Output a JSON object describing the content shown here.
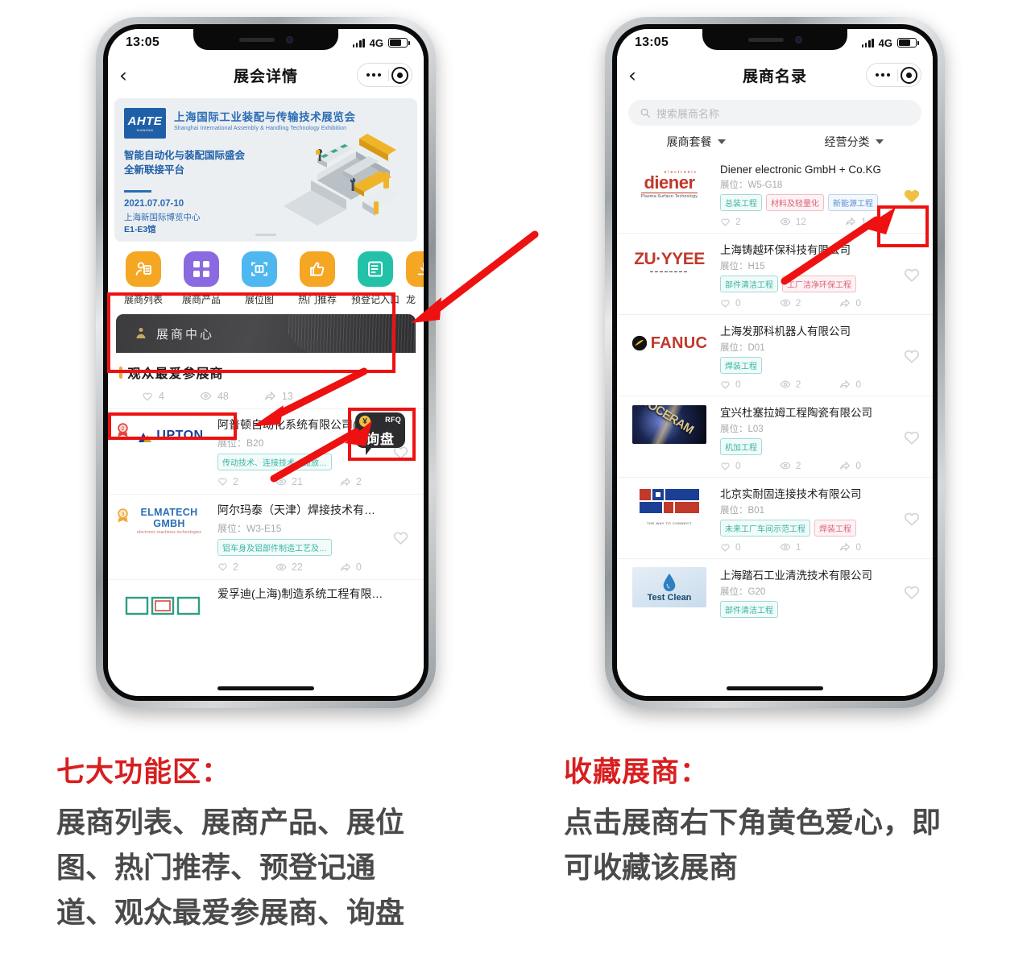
{
  "left_phone": {
    "status": {
      "time": "13:05",
      "network": "4G"
    },
    "nav": {
      "back_icon": "chevron-left-icon",
      "title": "展会详情",
      "more_icon": "more-dots-icon",
      "capsule_icon": "target-icon"
    },
    "banner": {
      "logo_text": "AHTE",
      "logo_sub": "SHANGHAI",
      "title_cn": "上海国际工业装配与传输技术展览会",
      "title_en": "Shanghai International Assembly & Handling Technology Exhibition",
      "slogan_line1": "智能自动化与装配国际盛会",
      "slogan_line2": "全新联接平台",
      "date": "2021.07.07-10",
      "venue": "上海新国际博览中心",
      "hall": "E1-E3馆"
    },
    "icon_menu": [
      {
        "label": "展商列表",
        "icon": "exhibitor-list-icon",
        "color": "#f5a623"
      },
      {
        "label": "展商产品",
        "icon": "grid-products-icon",
        "color": "#8a6ae0"
      },
      {
        "label": "展位图",
        "icon": "floor-plan-icon",
        "color": "#4fb7f0"
      },
      {
        "label": "热门推荐",
        "icon": "thumbs-up-icon",
        "color": "#f5a623"
      },
      {
        "label": "预登记入口",
        "icon": "document-icon",
        "color": "#23c2a8"
      },
      {
        "label": "龙",
        "icon": "partial-icon",
        "color": "#f5a623"
      }
    ],
    "center_card": {
      "label": "展商中心",
      "icon": "person-icon"
    },
    "section": {
      "title": "观众最爱参展商"
    },
    "rfq_button": {
      "badge": "RFQ",
      "label": "询盘",
      "currency": "¥"
    },
    "top_stats": {
      "likes": "4",
      "views": "48",
      "shares": "13"
    },
    "exhibitors": [
      {
        "rank": "2",
        "logo": "UPTON",
        "name": "阿普顿自动化系统有限公司(苏…",
        "booth_label": "展位：",
        "booth": "B20",
        "tags": [
          {
            "text": "传动技术、连接技术、搬放…",
            "style": "teal"
          }
        ],
        "likes": "2",
        "views": "21",
        "shares": "2",
        "favorited": false
      },
      {
        "rank": "3",
        "logo": "ELMATECH GMBH",
        "logo_sub": "electronic    machines    technologies",
        "name": "阿尔玛泰（天津）焊接技术有限…",
        "booth_label": "展位：",
        "booth": "W3-E15",
        "tags": [
          {
            "text": "铝车身及铝部件制造工艺及…",
            "style": "teal"
          }
        ],
        "likes": "2",
        "views": "22",
        "shares": "0",
        "favorited": false
      },
      {
        "rank": "",
        "logo": "",
        "name": "爱孚迪(上海)制造系统工程有限…",
        "booth_label": "",
        "booth": "",
        "tags": [],
        "likes": "",
        "views": "",
        "shares": "",
        "favorited": false
      }
    ]
  },
  "right_phone": {
    "status": {
      "time": "13:05",
      "network": "4G"
    },
    "nav": {
      "back_icon": "chevron-left-icon",
      "title": "展商名录",
      "more_icon": "more-dots-icon",
      "capsule_icon": "target-icon"
    },
    "search": {
      "placeholder": "搜索展商名称",
      "icon": "search-icon"
    },
    "filters": [
      {
        "label": "展商套餐",
        "icon": "chevron-down-icon"
      },
      {
        "label": "经营分类",
        "icon": "chevron-down-icon"
      }
    ],
    "exhibitors": [
      {
        "logo": "diener",
        "logo_top": "electronic",
        "logo_sub": "Plasma-Surface-Technology",
        "name": "Diener electronic GmbH + Co.KG",
        "booth_label": "展位：",
        "booth": "W5-G18",
        "tags": [
          {
            "text": "总装工程",
            "style": "teal"
          },
          {
            "text": "材料及轻量化",
            "style": "pink"
          },
          {
            "text": "新能源工程",
            "style": "blue"
          }
        ],
        "likes": "2",
        "views": "12",
        "shares": "1",
        "favorited": true
      },
      {
        "logo": "ZU·YYEE",
        "name": "上海铸越环保科技有限公司",
        "booth_label": "展位：",
        "booth": "H15",
        "tags": [
          {
            "text": "部件清洁工程",
            "style": "teal"
          },
          {
            "text": "工厂洁净环保工程",
            "style": "pink"
          }
        ],
        "likes": "0",
        "views": "2",
        "shares": "0",
        "favorited": false
      },
      {
        "logo": "FANUC",
        "name": "上海发那科机器人有限公司",
        "booth_label": "展位：",
        "booth": "D01",
        "tags": [
          {
            "text": "焊装工程",
            "style": "teal"
          }
        ],
        "likes": "0",
        "views": "2",
        "shares": "0",
        "favorited": false
      },
      {
        "logo": "DOCERAM",
        "name": "宜兴杜塞拉姆工程陶瓷有限公司",
        "booth_label": "展位：",
        "booth": "L03",
        "tags": [
          {
            "text": "机加工程",
            "style": "teal"
          }
        ],
        "likes": "0",
        "views": "2",
        "shares": "0",
        "favorited": false
      },
      {
        "logo": "THE WAY TO CONNECT",
        "name": "北京实耐固连接技术有限公司",
        "booth_label": "展位：",
        "booth": "B01",
        "tags": [
          {
            "text": "未来工厂车间示范工程",
            "style": "teal"
          },
          {
            "text": "焊装工程",
            "style": "pink"
          }
        ],
        "likes": "0",
        "views": "1",
        "shares": "0",
        "favorited": false
      },
      {
        "logo": "Test Clean",
        "name": "上海踏石工业清洗技术有限公司",
        "booth_label": "展位：",
        "booth": "G20",
        "tags": [
          {
            "text": "部件清洁工程",
            "style": "teal"
          }
        ],
        "likes": "",
        "views": "",
        "shares": "",
        "favorited": false
      }
    ]
  },
  "captions": {
    "left": {
      "heading": "七大功能区：",
      "line1": "展商列表、展商产品、展位",
      "line2": "图、热门推荐、预登记通",
      "line3": "道、观众最爱参展商、询盘"
    },
    "right": {
      "heading": "收藏展商：",
      "line1": "点击展商右下角黄色爱心，即",
      "line2": "可收藏该展商"
    }
  },
  "colors": {
    "annotation_red": "#ee1111",
    "heading_red": "#d81f20",
    "favorite_yellow": "#f0c044",
    "accent_orange": "#f0a93c"
  }
}
